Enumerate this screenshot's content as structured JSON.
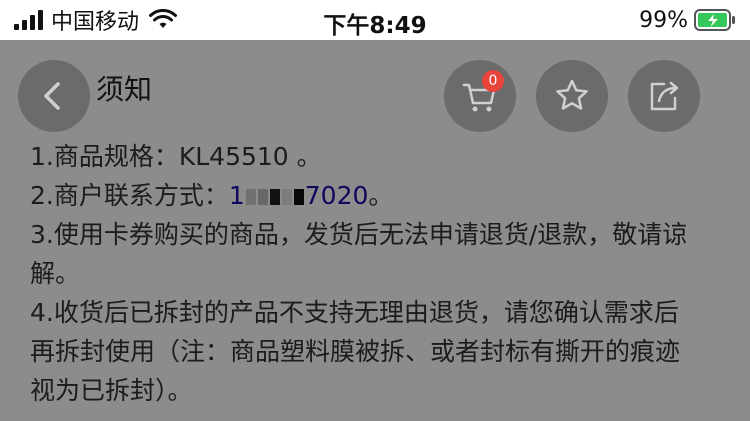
{
  "status_bar": {
    "carrier": "中国移动",
    "time": "下午8:49",
    "battery_percent": "99%"
  },
  "notice": {
    "title_visible": "须知",
    "items": [
      "1.商品规格：KL45510 。",
      "2.商户联系方式：",
      "3.使用卡券购买的商品，发货后无法申请退货/退款，敬请谅",
      "解。",
      "4.收货后已拆封的产品不支持无理由退货，请您确认需求后",
      "再拆封使用（注：商品塑料膜被拆、或者封标有撕开的痕迹",
      "视为已拆封）。"
    ],
    "phone_prefix": "1",
    "phone_suffix": "7020",
    "phone_end": "。"
  },
  "toolbar": {
    "back_icon": "chevron-left-icon",
    "cart_icon": "cart-icon",
    "cart_count": "0",
    "favorite_icon": "star-icon",
    "share_icon": "share-icon"
  },
  "colors": {
    "overlay": "#000000",
    "badge": "#e8443c",
    "link": "#1a0dab"
  }
}
